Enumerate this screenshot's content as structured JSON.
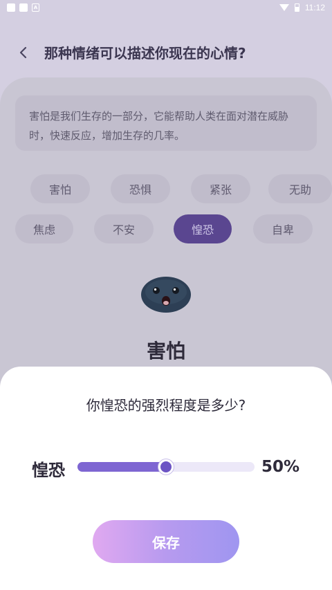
{
  "status_bar": {
    "time": "11:12",
    "notif_icon": "A"
  },
  "header": {
    "back_icon": "chevron-left-icon",
    "title": "那种情绪可以描述你现在的心情?"
  },
  "description": "害怕是我们生存的一部分，它能帮助人类在面对潜在威胁时，快速反应，增加生存的几率。",
  "chips": {
    "row1": [
      "害怕",
      "恐惧",
      "紧张",
      "无助"
    ],
    "row2": [
      "焦虑",
      "不安",
      "惶恐",
      "自卑"
    ],
    "active": "惶恐"
  },
  "emotion": {
    "icon": "scared-face-icon",
    "name": "害怕"
  },
  "sheet": {
    "title": "你惶恐的强烈程度是多少?",
    "slider_label": "惶恐",
    "slider_value_text": "50%",
    "slider_value": 0.5,
    "save_label": "保存"
  },
  "colors": {
    "accent": "#7e66d2",
    "active_chip": "#5a4690",
    "save_gradient": [
      "#e0a9f0",
      "#9f96f0"
    ]
  }
}
